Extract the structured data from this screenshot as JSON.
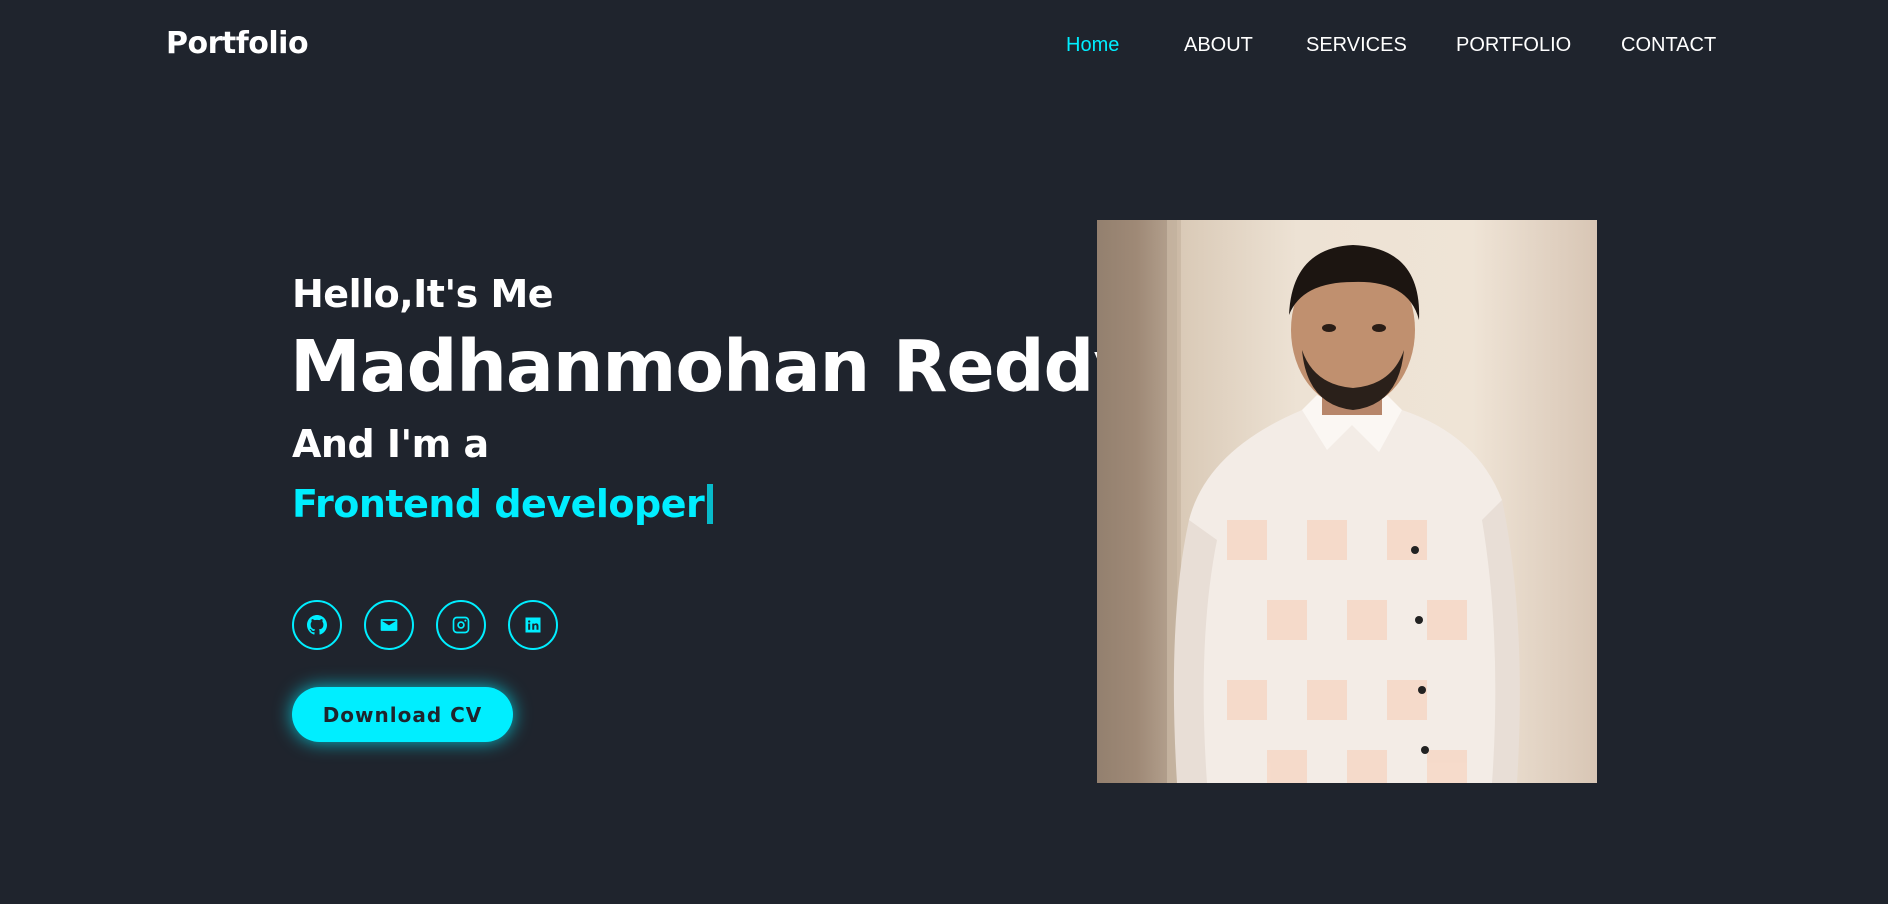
{
  "header": {
    "logo": "Portfolio",
    "nav": [
      {
        "label": "Home",
        "active": true
      },
      {
        "label": "ABOUT",
        "active": false
      },
      {
        "label": "SERVICES",
        "active": false
      },
      {
        "label": "PORTFOLIO",
        "active": false
      },
      {
        "label": "CONTACT",
        "active": false
      }
    ]
  },
  "hero": {
    "greeting": "Hello,It's Me",
    "name": "Madhanmohan Reddy",
    "subtitle": "And I'm a",
    "role": "Frontend developer",
    "social": [
      {
        "icon": "github-icon"
      },
      {
        "icon": "mail-icon"
      },
      {
        "icon": "instagram-icon"
      },
      {
        "icon": "linkedin-icon"
      }
    ],
    "cv_button": "Download CV"
  },
  "colors": {
    "background": "#1f242d",
    "accent": "#00eeff",
    "text": "#ffffff"
  }
}
